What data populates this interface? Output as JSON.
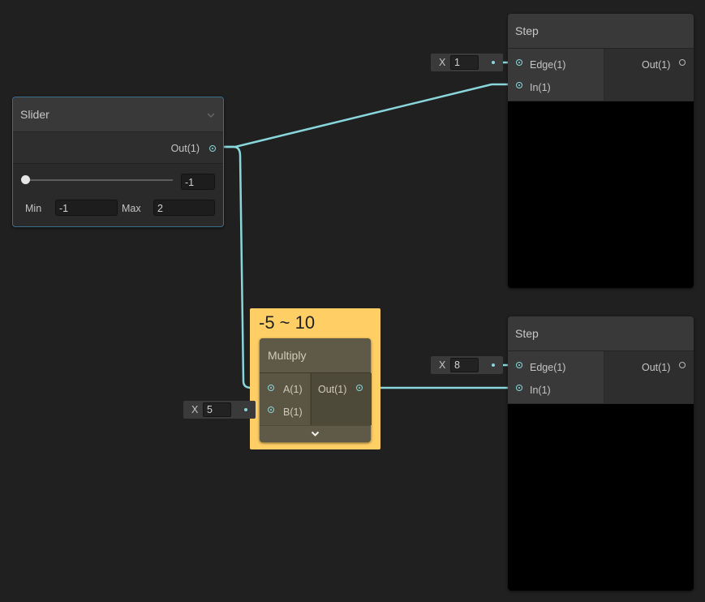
{
  "colors": {
    "canvas": "#202020",
    "wire": "#89d6dc",
    "group": "#ffcf66",
    "node_header": "#393939",
    "node_body": "#2a2a2a",
    "selected_outline": "#3e6e8e"
  },
  "slider_node": {
    "title": "Slider",
    "output_label": "Out(1)",
    "value": "-1",
    "slider_fraction": 0,
    "min_label": "Min",
    "min_value": "-1",
    "max_label": "Max",
    "max_value": "2",
    "collapse_icon": "chevron-down-icon"
  },
  "group": {
    "title": "-5 ~ 10"
  },
  "multiply_node": {
    "title": "Multiply",
    "input_a_label": "A(1)",
    "input_b_label": "B(1)",
    "output_label": "Out(1)",
    "expand_icon": "chevron-down-icon",
    "b_inline": {
      "axis": "X",
      "value": "5"
    }
  },
  "step_nodes": [
    {
      "title": "Step",
      "edge_label": "Edge(1)",
      "in_label": "In(1)",
      "out_label": "Out(1)",
      "edge_inline": {
        "axis": "X",
        "value": "1"
      }
    },
    {
      "title": "Step",
      "edge_label": "Edge(1)",
      "in_label": "In(1)",
      "out_label": "Out(1)",
      "edge_inline": {
        "axis": "X",
        "value": "8"
      }
    }
  ]
}
